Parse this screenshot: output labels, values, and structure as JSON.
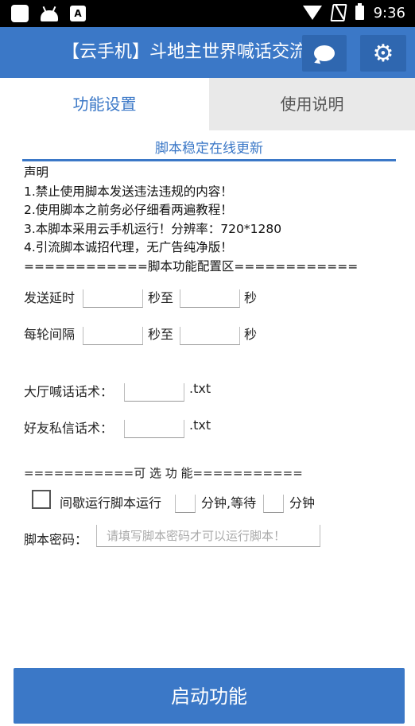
{
  "status_bar": {
    "time": "9:36",
    "icons": [
      "square-icon",
      "android-icon",
      "accessibility-icon",
      "wifi-icon",
      "no-signal-icon",
      "battery-icon"
    ]
  },
  "app_bar": {
    "title": "【云手机】斗地主世界喊话交流",
    "chat_icon": "chat-bubble-icon",
    "settings_icon": "gear-icon"
  },
  "tabs": [
    {
      "label": "功能设置",
      "active": true
    },
    {
      "label": "使用说明",
      "active": false
    }
  ],
  "update_notice": "脚本稳定在线更新",
  "notice": [
    "声明",
    "1.禁止使用脚本发送违法违规的内容！",
    "2.使用脚本之前务必仔细看两遍教程！",
    "3.本脚本采用云手机运行！分辨率：720*1280",
    "4.引流脚本诚招代理，无广告纯净版！",
    "============脚本功能配置区============"
  ],
  "send_delay": {
    "label": "发送延时",
    "to": "秒至",
    "unit": "秒",
    "min": "",
    "max": ""
  },
  "round_interval": {
    "label": "每轮间隔",
    "to": "秒至",
    "unit": "秒",
    "min": "",
    "max": ""
  },
  "lobby_script": {
    "label": "大厅喊话话术：",
    "value": "",
    "suffix": ".txt"
  },
  "friend_script": {
    "label": "好友私信话术：",
    "value": "",
    "suffix": ".txt"
  },
  "optional_header": "===========可 选 功 能===========",
  "intermittent": {
    "checked": false,
    "label": "间歇运行脚本运行",
    "mid": "分钟,等待",
    "unit": "分钟",
    "run_minutes": "",
    "wait_minutes": ""
  },
  "password": {
    "label": "脚本密码：",
    "placeholder": "请填写脚本密码才可以运行脚本！",
    "value": ""
  },
  "start_button": "启动功能",
  "colors": {
    "primary": "#3b78c7",
    "primary_dark": "#2f67b0",
    "tab_inactive": "#e9e9e9"
  }
}
